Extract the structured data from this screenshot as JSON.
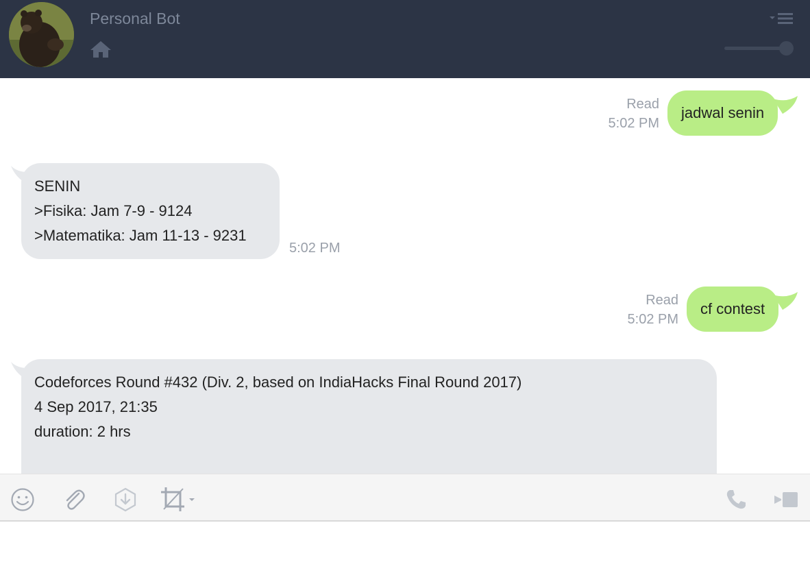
{
  "header": {
    "title": "Personal Bot",
    "icons": {
      "home": "home-icon",
      "menu": "menu-icon"
    }
  },
  "messages": [
    {
      "direction": "out",
      "text": "jadwal senin",
      "status": "Read",
      "time": "5:02 PM"
    },
    {
      "direction": "in",
      "lines": [
        "SENIN",
        ">Fisika: Jam 7-9 - 9124",
        ">Matematika: Jam 11-13 - 9231"
      ],
      "time": "5:02 PM"
    },
    {
      "direction": "out",
      "text": "cf contest",
      "status": "Read",
      "time": "5:02 PM"
    },
    {
      "direction": "in",
      "lines": [
        "Codeforces Round #432 (Div. 2, based on IndiaHacks Final Round 2017)",
        "4 Sep 2017, 21:35",
        "duration: 2 hrs"
      ]
    }
  ],
  "toolbar": {
    "icons": [
      "emoji-icon",
      "attach-icon",
      "download-icon",
      "screenshot-crop-icon",
      "call-icon",
      "video-call-icon"
    ]
  },
  "colors": {
    "header_bg": "#2c3445",
    "outgoing_bubble": "#b9ed86",
    "incoming_bubble": "#e6e8eb",
    "meta_text": "#9aa0aa"
  }
}
